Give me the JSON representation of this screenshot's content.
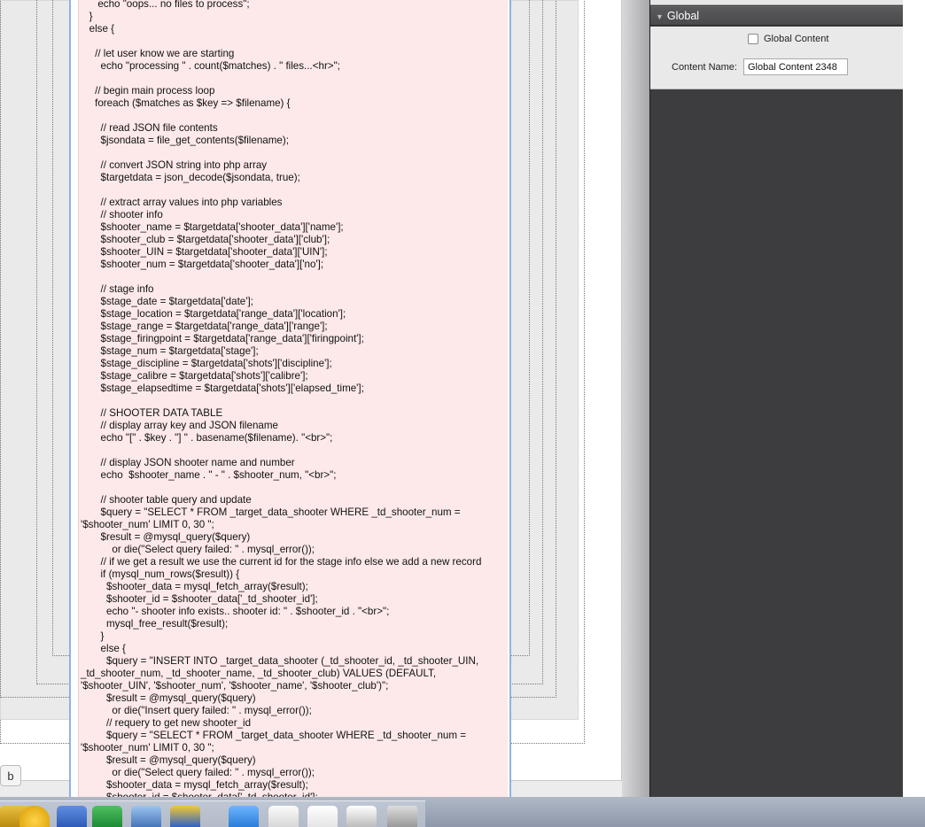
{
  "inspector": {
    "section_title": "Global",
    "global_content_label": "Global Content",
    "content_name_label": "Content Name:",
    "content_name_value": "Global Content 2348"
  },
  "canvas": {
    "small_button_label": "b"
  },
  "code_lines": [
    "      echo \"oops... no files to process\";",
    "   }",
    "   else {",
    "",
    "     // let user know we are starting",
    "       echo \"processing \" . count($matches) . \" files...<hr>\";",
    "",
    "     // begin main process loop",
    "     foreach ($matches as $key => $filename) {",
    "",
    "       // read JSON file contents",
    "       $jsondata = file_get_contents($filename);",
    "",
    "       // convert JSON string into php array",
    "       $targetdata = json_decode($jsondata, true);",
    "",
    "       // extract array values into php variables",
    "       // shooter info",
    "       $shooter_name = $targetdata['shooter_data']['name'];",
    "       $shooter_club = $targetdata['shooter_data']['club'];",
    "       $shooter_UIN = $targetdata['shooter_data']['UIN'];",
    "       $shooter_num = $targetdata['shooter_data']['no'];",
    "",
    "       // stage info",
    "       $stage_date = $targetdata['date'];",
    "       $stage_location = $targetdata['range_data']['location'];",
    "       $stage_range = $targetdata['range_data']['range'];",
    "       $stage_firingpoint = $targetdata['range_data']['firingpoint'];",
    "       $stage_num = $targetdata['stage'];",
    "       $stage_discipline = $targetdata['shots']['discipline'];",
    "       $stage_calibre = $targetdata['shots']['calibre'];",
    "       $stage_elapsedtime = $targetdata['shots']['elapsed_time'];",
    "",
    "       // SHOOTER DATA TABLE",
    "       // display array key and JSON filename",
    "       echo \"[\" . $key . \"] \" . basename($filename). \"<br>\";",
    "",
    "       // display JSON shooter name and number",
    "       echo  $shooter_name . \" - \" . $shooter_num, \"<br>\";",
    "",
    "       // shooter table query and update",
    "       $query = \"SELECT * FROM _target_data_shooter WHERE _td_shooter_num =",
    "'$shooter_num' LIMIT 0, 30 \";",
    "       $result = @mysql_query($query)",
    "           or die(\"Select query failed: \" . mysql_error());",
    "       // if we get a result we use the current id for the stage info else we add a new record",
    "       if (mysql_num_rows($result)) {",
    "         $shooter_data = mysql_fetch_array($result);",
    "         $shooter_id = $shooter_data['_td_shooter_id'];",
    "         echo \"- shooter info exists.. shooter id: \" . $shooter_id . \"<br>\";",
    "         mysql_free_result($result);",
    "       }",
    "       else {",
    "         $query = \"INSERT INTO _target_data_shooter (_td_shooter_id, _td_shooter_UIN,",
    "_td_shooter_num, _td_shooter_name, _td_shooter_club) VALUES (DEFAULT,",
    "'$shooter_UIN', '$shooter_num', '$shooter_name', '$shooter_club')\";",
    "         $result = @mysql_query($query)",
    "           or die(\"Insert query failed: \" . mysql_error());",
    "         // requery to get new shooter_id",
    "         $query = \"SELECT * FROM _target_data_shooter WHERE _td_shooter_num =",
    "'$shooter_num' LIMIT 0, 30 \";",
    "         $result = @mysql_query($query)",
    "           or die(\"Select query failed: \" . mysql_error());",
    "         $shooter_data = mysql_fetch_array($result);",
    "         $shooter_id = $shooter_data['_td_shooter_id'];"
  ]
}
